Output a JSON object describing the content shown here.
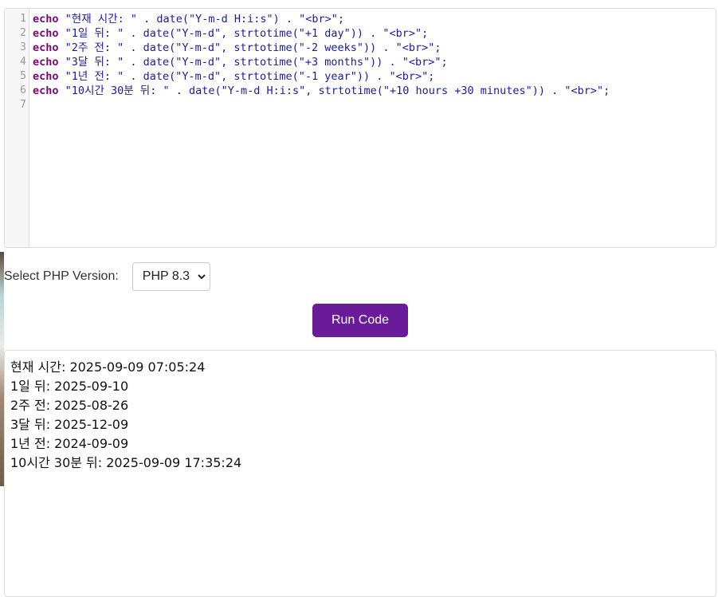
{
  "editor": {
    "line_numbers": [
      "1",
      "2",
      "3",
      "4",
      "5",
      "6",
      "7"
    ],
    "lines": [
      [
        {
          "t": "kw",
          "v": "echo"
        },
        {
          "t": "str",
          "v": " \"현재 시간: \""
        },
        {
          "t": "plain",
          "v": " . "
        },
        {
          "t": "str",
          "v": "date(\"Y-m-d H:i:s\") . \"<br>\";"
        }
      ],
      [
        {
          "t": "kw",
          "v": "echo"
        },
        {
          "t": "str",
          "v": " \"1일 뒤: \""
        },
        {
          "t": "plain",
          "v": " . "
        },
        {
          "t": "str",
          "v": "date(\"Y-m-d\", strtotime(\"+1 day\")) . \"<br>\";"
        }
      ],
      [
        {
          "t": "kw",
          "v": "echo"
        },
        {
          "t": "str",
          "v": " \"2주 전: \""
        },
        {
          "t": "plain",
          "v": " . "
        },
        {
          "t": "str",
          "v": "date(\"Y-m-d\", strtotime(\"-2 weeks\")) . \"<br>\";"
        }
      ],
      [
        {
          "t": "kw",
          "v": "echo"
        },
        {
          "t": "str",
          "v": " \"3달 뒤: \""
        },
        {
          "t": "plain",
          "v": " . "
        },
        {
          "t": "str",
          "v": "date(\"Y-m-d\", strtotime(\"+3 months\")) . \"<br>\";"
        }
      ],
      [
        {
          "t": "kw",
          "v": "echo"
        },
        {
          "t": "str",
          "v": " \"1년 전: \""
        },
        {
          "t": "plain",
          "v": " . "
        },
        {
          "t": "str",
          "v": "date(\"Y-m-d\", strtotime(\"-1 year\")) . \"<br>\";"
        }
      ],
      [
        {
          "t": "kw",
          "v": "echo"
        },
        {
          "t": "str",
          "v": " \"10시간 30분 뒤: \""
        },
        {
          "t": "plain",
          "v": " . "
        },
        {
          "t": "str",
          "v": "date(\"Y-m-d H:i:s\", strtotime(\"+10 hours +30 minutes\")) . \"<br>\";"
        }
      ],
      []
    ]
  },
  "version": {
    "label": "Select PHP Version:",
    "selected": "PHP 8.3",
    "chevron_icon": "chevron-down-icon"
  },
  "run_button": {
    "label": "Run Code",
    "color": "#6a1b9a"
  },
  "output": {
    "lines": [
      "현재 시간: 2025-09-09 07:05:24",
      "1일 뒤: 2025-09-10",
      "2주 전: 2025-08-26",
      "3달 뒤: 2025-12-09",
      "1년 전: 2024-09-09",
      "10시간 30분 뒤: 2025-09-09 17:35:24"
    ]
  },
  "colors": {
    "keyword": "#7a0874",
    "string": "#1a1aa6",
    "gutter_bg": "#f7f7f7"
  }
}
